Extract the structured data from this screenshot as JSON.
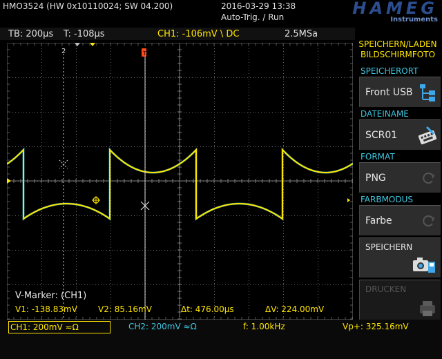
{
  "header": {
    "model": "HMO3524 (HW 0x10110024; SW 04.200)",
    "datetime": "2016-03-29 13:38",
    "trigger_status": "Auto-Trig. / Run",
    "brand": "HAMEG",
    "brand_sub": "Instruments"
  },
  "status_bar": {
    "timebase": "TB: 200µs",
    "trigger_time": "T: -108µs",
    "trigger_info": "CH1: -106mV \\ DC",
    "sample_rate": "2.5MSa"
  },
  "plot": {
    "marker_label": "2",
    "trigger_marker": "T",
    "channel_ref": "1",
    "vmarker": {
      "title": "V-Marker: (CH1)",
      "v1": "V1: -138.83mV",
      "v2": "V2: 85.16mV",
      "dt": "Δt: 476.00µs",
      "dv": "ΔV: 224.00mV"
    }
  },
  "bottom_bar": {
    "ch1": "CH1: 200mV ≈Ω",
    "ch2": "CH2: 200mV ≈Ω",
    "freq": "f: 1.00kHz",
    "vpp": "Vp+: 325.16mV"
  },
  "menu": {
    "title_line1": "SPEICHERN/LADEN",
    "title_line2": "BILDSCHIRMFOTO",
    "items": [
      {
        "label": "SPEICHERORT",
        "value": "Front USB",
        "icon": "usb-tree-icon"
      },
      {
        "label": "DATEINAME",
        "value": "SCR01",
        "icon": "keyboard-edit-icon"
      },
      {
        "label": "FORMAT",
        "value": "PNG",
        "icon": "cycle-arrow-icon"
      },
      {
        "label": "FARBMODUS",
        "value": "Farbe",
        "icon": "cycle-arrow-icon"
      }
    ],
    "save_label": "SPEICHERN",
    "print_label": "DRUCKEN"
  },
  "colors": {
    "ch1": "#ffe600",
    "ch2": "#3fc6e0",
    "grid": "#6a6a6a",
    "trigger": "#ff4a1a",
    "menu_label": "#3fc6e0"
  }
}
